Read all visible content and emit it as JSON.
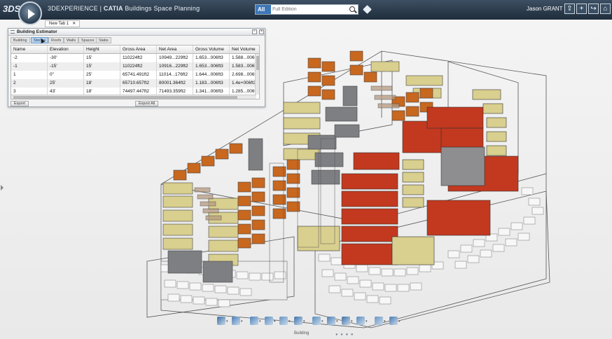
{
  "topbar": {
    "brand_logo": "3DS",
    "app_title_prefix": "3DEXPERIENCE | ",
    "app_title_brand": "CATIA",
    "app_title_suffix": " Buildings Space Planning",
    "search_scope": "All",
    "search_placeholder": "Full Edition",
    "user_name": "Jason GRANT",
    "icons": [
      "compass-icon",
      "search-icon",
      "tag-icon",
      "share-icon",
      "add-icon",
      "forward-icon",
      "home-icon"
    ]
  },
  "tabs": [
    {
      "label": "New Tab 1",
      "close": "✕"
    }
  ],
  "panel": {
    "title": "Building Estimator",
    "tabs": [
      "Building",
      "Stories",
      "Roofs",
      "Walls",
      "Spaces",
      "Slabs"
    ],
    "active_tab": "Stories",
    "columns": [
      "Name",
      "Elevation",
      "Height",
      "Gross Area",
      "Net Area",
      "Gross Volume",
      "Net Volume"
    ],
    "rows": [
      [
        "-2",
        "-30'",
        "15'",
        "110224ft2",
        "10949...229ft2",
        "1.653...006ft3",
        "1.588...006ft3"
      ],
      [
        "-1",
        "-15'",
        "15'",
        "110224ft2",
        "10916...229ft2",
        "1.653...006ft3",
        "1.583...006ft3"
      ],
      [
        "1",
        "0\"",
        "25'",
        "65741.491ft2",
        "11014...176ft2",
        "1.644...006ft3",
        "2.698...006ft3"
      ],
      [
        "2",
        "25'",
        "18'",
        "65710.657ft2",
        "80001.364ft2",
        "1.183...006ft3",
        "1.4e+006ft3"
      ],
      [
        "3",
        "43'",
        "18'",
        "74497.447ft2",
        "71493.359ft2",
        "1.341...006ft3",
        "1.285...006ft3"
      ]
    ],
    "buttons": {
      "export": "Export",
      "export_all": "Export All"
    }
  },
  "viewport": {
    "colors": {
      "orange": "#c8671e",
      "khaki": "#d9cf8e",
      "red": "#c2391f",
      "grey": "#7d7f83",
      "white_blocks": "#eeeeee",
      "outline": "#444444"
    }
  },
  "toolbar": {
    "label": "Building",
    "page_dots": "● ● ● ●",
    "tools": [
      "undo-icon",
      "select-icon",
      "space-icon",
      "slab-icon",
      "story-icon",
      "pointer-icon",
      "measure-icon",
      "door-icon",
      "box-icon",
      "grid-icon",
      "layers-icon",
      "settings-icon"
    ]
  }
}
